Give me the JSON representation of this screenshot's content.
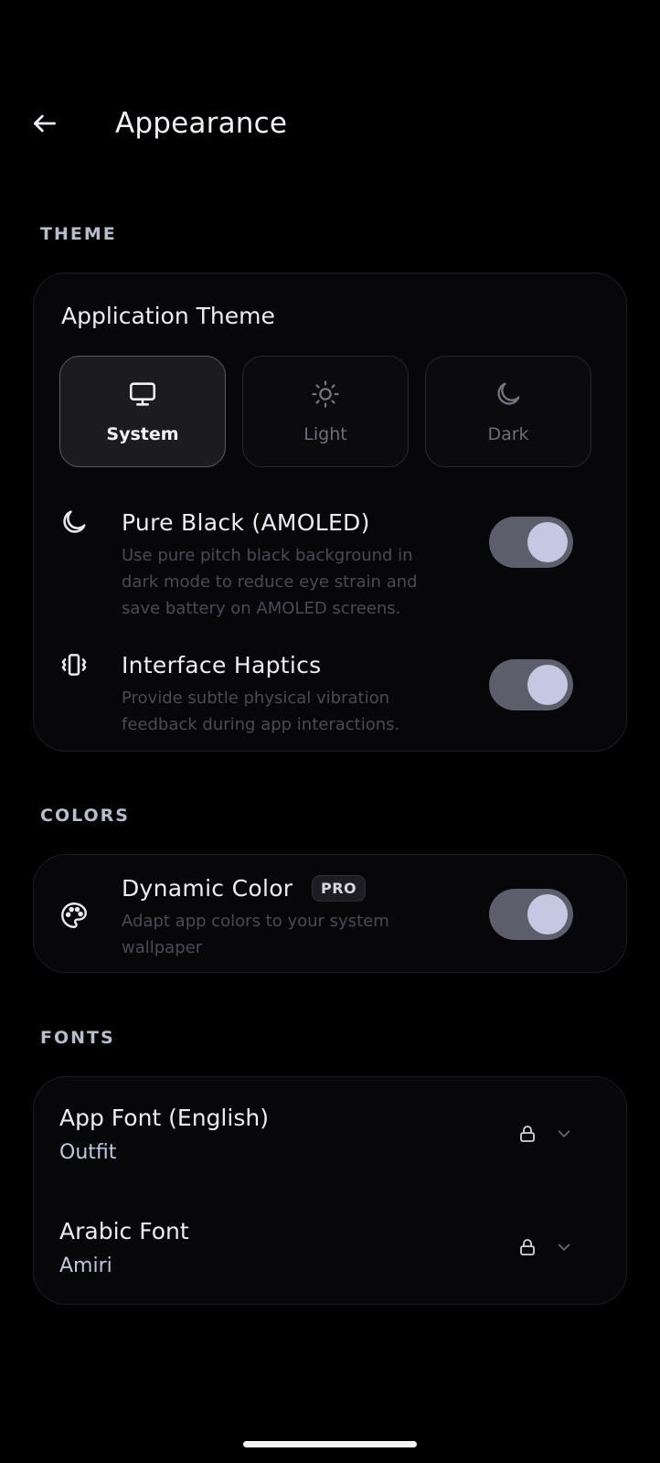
{
  "header": {
    "title": "Appearance"
  },
  "sections": {
    "theme": "THEME",
    "colors": "COLORS",
    "fonts": "FONTS"
  },
  "theme_card": {
    "heading": "Application Theme",
    "options": [
      {
        "label": "System",
        "icon": "monitor-icon",
        "selected": true
      },
      {
        "label": "Light",
        "icon": "sun-icon",
        "selected": false
      },
      {
        "label": "Dark",
        "icon": "moon-icon",
        "selected": false
      }
    ],
    "pure_black": {
      "title": "Pure Black (AMOLED)",
      "description_lines": [
        "Use pure pitch black background in",
        "dark mode to reduce eye strain and",
        "save battery on AMOLED screens."
      ],
      "enabled": true
    },
    "haptics": {
      "title": "Interface Haptics",
      "description_lines": [
        "Provide subtle physical vibration",
        "feedback during app interactions."
      ],
      "enabled": true
    }
  },
  "colors_card": {
    "dynamic_color": {
      "title": "Dynamic Color",
      "badge": "PRO",
      "description_lines": [
        "Adapt app colors to your system",
        "wallpaper"
      ],
      "enabled": true
    }
  },
  "fonts_card": {
    "app_font": {
      "label": "App Font (English)",
      "value": "Outfit"
    },
    "arabic_font": {
      "label": "Arabic Font",
      "value": "Amiri"
    }
  },
  "colors": {
    "background": "#000000",
    "toggle_track": "#5d5e6b",
    "toggle_knob": "#c6c7e1"
  }
}
